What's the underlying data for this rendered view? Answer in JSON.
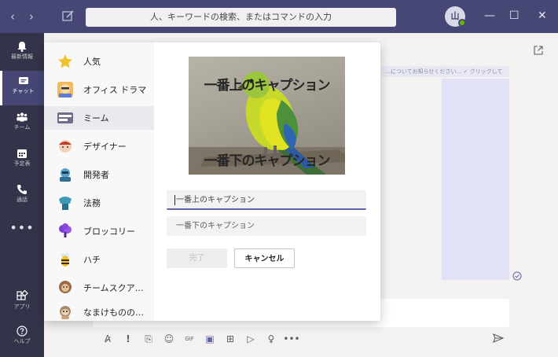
{
  "titlebar": {
    "search_placeholder": "人、キーワードの検索、またはコマンドの入力",
    "avatar_initials": "山",
    "presence_color": "#6bb700",
    "back_glyph": "‹",
    "forward_glyph": "›",
    "minimize_glyph": "—",
    "maximize_glyph": "☐",
    "close_glyph": "✕"
  },
  "rail": {
    "items": [
      {
        "label": "最新情報",
        "icon": "bell-icon"
      },
      {
        "label": "チャット",
        "icon": "chat-icon",
        "active": true
      },
      {
        "label": "チーム",
        "icon": "teams-icon"
      },
      {
        "label": "予定表",
        "icon": "calendar-icon"
      },
      {
        "label": "通話",
        "icon": "phone-icon"
      }
    ],
    "more_glyph": "•••",
    "apps_label": "アプリ",
    "help_label": "ヘルプ"
  },
  "meme_picker": {
    "categories": [
      {
        "label": "人気",
        "icon": "star-icon"
      },
      {
        "label": "オフィス ドラマ",
        "icon": "office-drama-icon"
      },
      {
        "label": "ミーム",
        "icon": "meme-icon",
        "selected": true
      },
      {
        "label": "デザイナー",
        "icon": "designer-icon"
      },
      {
        "label": "開発者",
        "icon": "developer-icon"
      },
      {
        "label": "法務",
        "icon": "legal-icon"
      },
      {
        "label": "ブロッコリー",
        "icon": "broccoli-icon"
      },
      {
        "label": "ハチ",
        "icon": "bee-icon"
      },
      {
        "label": "チームスクアッチ",
        "icon": "squatch-icon"
      },
      {
        "label": "なまけもののバ...",
        "icon": "sloth-icon"
      }
    ],
    "preview": {
      "top_caption": "一番上のキャプション",
      "bottom_caption": "一番下のキャプション"
    },
    "top_caption_field": {
      "value": "一番上のキャプション"
    },
    "bottom_caption_field": {
      "value": "一番下のキャプション"
    },
    "done_label": "完了",
    "cancel_label": "キャンセル"
  },
  "chat": {
    "message_snippet": "…についてお知らせください… ✓ クリックして"
  },
  "compose_toolbar": {
    "icons": [
      "format-icon",
      "important-icon",
      "attach-icon",
      "emoji-icon",
      "gif-icon",
      "sticker-icon",
      "meet-icon",
      "stream-icon",
      "praise-icon",
      "more-options-icon"
    ],
    "glyphs": [
      "A̷",
      "!",
      "⎘",
      "☺",
      "GIF",
      "▣",
      "⊞",
      "▷",
      "♀",
      "•••"
    ]
  }
}
